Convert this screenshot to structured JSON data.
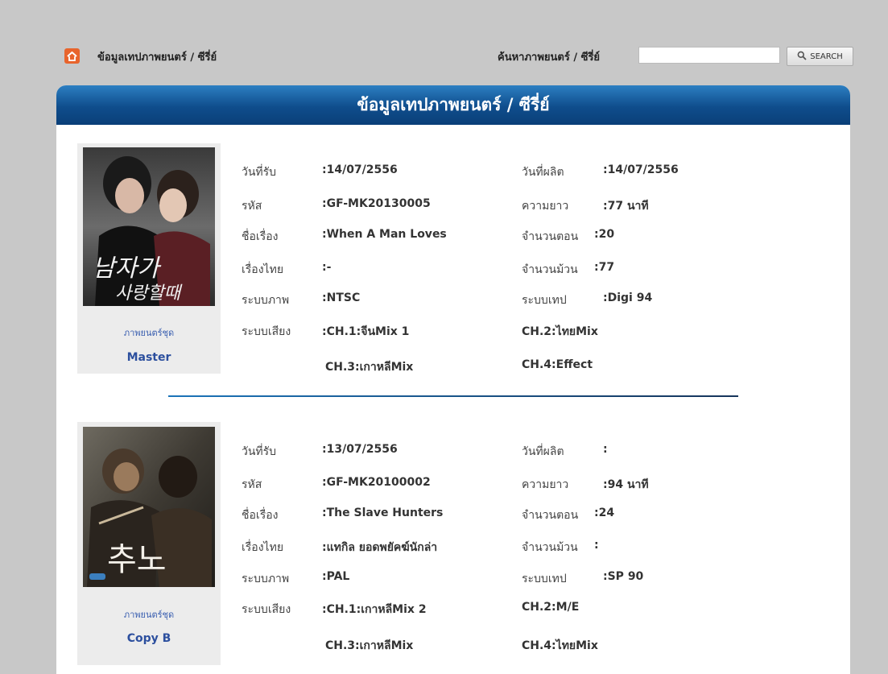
{
  "header": {
    "site_title": "ข้อมูลเทปภาพยนตร์ / ซีรี่ย์",
    "search_label": "ค้นหาภาพยนตร์ / ซีรี่ย์",
    "search_value": "",
    "search_button": "SEARCH",
    "home_icon": "home-icon",
    "search_icon": "magnifier-icon"
  },
  "panel": {
    "title": "ข้อมูลเทปภาพยนตร์ / ซีรี่ย์"
  },
  "colors": {
    "header_blue": "#0f4d8c",
    "accent_orange": "#e8642c",
    "link_blue": "#2c4f9e"
  },
  "records": [
    {
      "type_label": "ภาพยนตร์ชุด",
      "version": "Master",
      "fields": {
        "received_label": "วันที่รับ",
        "received_value": ":14/07/2556",
        "produced_label": "วันที่ผลิต",
        "produced_value": ":14/07/2556",
        "code_label": "รหัส",
        "code_value": ":GF-MK20130005",
        "length_label": "ความยาว",
        "length_value": ":77  นาที",
        "title_label": "ชื่อเรื่อง",
        "title_value": ":When A Man Loves",
        "episodes_label": "จำนวนตอน",
        "episodes_value": ":20",
        "thai_title_label": "เรื่องไทย",
        "thai_title_value": ":-",
        "reels_label": "จำนวนม้วน",
        "reels_value": ":77",
        "video_label": "ระบบภาพ",
        "video_value": ":NTSC",
        "tape_label": "ระบบเทป",
        "tape_value": ":Digi 94",
        "audio_label": "ระบบเสียง",
        "ch1": ":CH.1:จีนMix 1",
        "ch2": "CH.2:ไทยMix",
        "ch3": "CH.3:เกาหลีMix",
        "ch4": "CH.4:Effect"
      }
    },
    {
      "type_label": "ภาพยนตร์ชุด",
      "version": "Copy B",
      "fields": {
        "received_label": "วันที่รับ",
        "received_value": ":13/07/2556",
        "produced_label": "วันที่ผลิต",
        "produced_value": ":",
        "code_label": "รหัส",
        "code_value": ":GF-MK20100002",
        "length_label": "ความยาว",
        "length_value": ":94  นาที",
        "title_label": "ชื่อเรื่อง",
        "title_value": ":The Slave Hunters",
        "episodes_label": "จำนวนตอน",
        "episodes_value": ":24",
        "thai_title_label": "เรื่องไทย",
        "thai_title_value": ":แทกิล ยอดพยัคฆ์นักล่า",
        "reels_label": "จำนวนม้วน",
        "reels_value": ":",
        "video_label": "ระบบภาพ",
        "video_value": ":PAL",
        "tape_label": "ระบบเทป",
        "tape_value": ":SP 90",
        "audio_label": "ระบบเสียง",
        "ch1": ":CH.1:เกาหลีMix 2",
        "ch2": "CH.2:M/E",
        "ch3": "CH.3:เกาหลีMix",
        "ch4": "CH.4:ไทยMix"
      }
    }
  ]
}
